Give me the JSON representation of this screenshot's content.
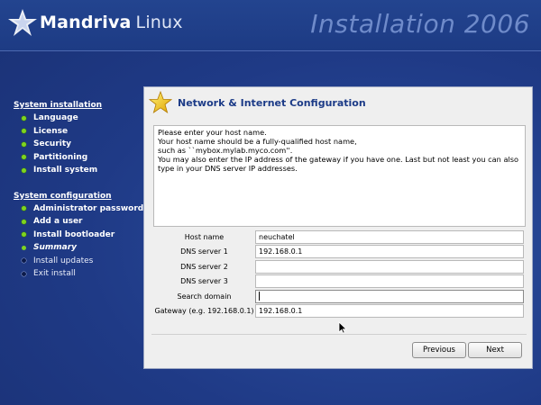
{
  "header": {
    "brand_bold": "Mandriva",
    "brand_light": "Linux",
    "edition": "Installation 2006"
  },
  "sidebar": {
    "sections": [
      {
        "title": "System installation",
        "steps": [
          {
            "label": "Language",
            "state": "done"
          },
          {
            "label": "License",
            "state": "done"
          },
          {
            "label": "Security",
            "state": "done"
          },
          {
            "label": "Partitioning",
            "state": "done"
          },
          {
            "label": "Install system",
            "state": "done"
          }
        ]
      },
      {
        "title": "System configuration",
        "steps": [
          {
            "label": "Administrator password",
            "state": "done"
          },
          {
            "label": "Add a user",
            "state": "done"
          },
          {
            "label": "Install bootloader",
            "state": "done"
          },
          {
            "label": "Summary",
            "state": "current"
          },
          {
            "label": "Install updates",
            "state": "todo"
          },
          {
            "label": "Exit install",
            "state": "todo"
          }
        ]
      }
    ]
  },
  "panel": {
    "title": "Network & Internet Configuration",
    "description": [
      "Please enter your host name.",
      "Your host name should be a fully-qualified host name,",
      "such as ``mybox.mylab.myco.com''.",
      "You may also enter the IP address of the gateway if you have one. Last but not least you can also type in your DNS server IP addresses."
    ],
    "fields": [
      {
        "label": "Host name",
        "value": "neuchatel"
      },
      {
        "label": "DNS server 1",
        "value": "192.168.0.1"
      },
      {
        "label": "DNS server 2",
        "value": ""
      },
      {
        "label": "DNS server 3",
        "value": ""
      },
      {
        "label": "Search domain",
        "value": ""
      },
      {
        "label": "Gateway (e.g. 192.168.0.1)",
        "value": "192.168.0.1"
      }
    ],
    "buttons": {
      "previous": "Previous",
      "next": "Next"
    }
  },
  "colors": {
    "background": "#23408e",
    "title": "#1c3b87",
    "done_dot": "#7ed321"
  },
  "icons": {
    "logo": "mandriva-star-icon",
    "panel": "gold-star-icon"
  }
}
